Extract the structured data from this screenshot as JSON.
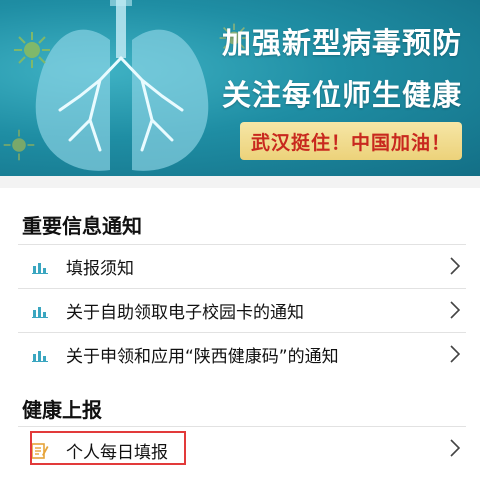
{
  "banner": {
    "line1": "加强新型病毒预防",
    "line2": "关注每位师生健康",
    "slogan": "武汉挺住！中国加油！"
  },
  "notices": {
    "title": "重要信息通知",
    "items": [
      {
        "label": "填报须知"
      },
      {
        "label": "关于自助领取电子校园卡的通知"
      },
      {
        "label": "关于申领和应用“陕西健康码”的通知"
      }
    ]
  },
  "health": {
    "title": "健康上报",
    "items": [
      {
        "label": "个人每日填报"
      }
    ]
  },
  "colors": {
    "banner_bg": "#1f8ea4",
    "slogan_bg": "#ecd27a",
    "slogan_text": "#c8281e",
    "icon_teal": "#3aa6c0",
    "icon_gold": "#e6a43a",
    "highlight_border": "#e23a3a"
  },
  "icons": {
    "notice_item": "bar-chart-icon",
    "report_item": "edit-form-icon",
    "chevron": "chevron-right-icon"
  }
}
